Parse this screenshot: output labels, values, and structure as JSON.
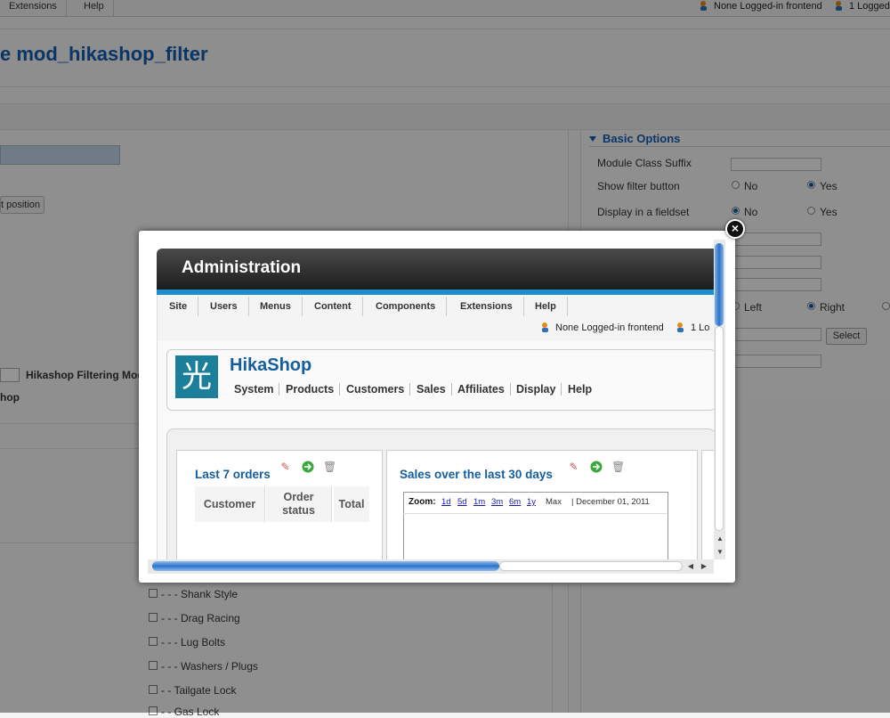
{
  "top_menu": {
    "extensions": "Extensions",
    "help": "Help"
  },
  "top_status": {
    "frontend": "None Logged-in frontend",
    "logged": "1 Logged"
  },
  "page_title": "e mod_hikashop_filter",
  "basic_options": {
    "title": "Basic Options",
    "module_class_suffix": "Module Class Suffix",
    "show_filter_button": "Show filter button",
    "display_in_fieldset": "Display in a fieldset",
    "no": "No",
    "yes": "Yes",
    "left": "Left",
    "right": "Right",
    "select": "Select"
  },
  "left_panel": {
    "position_button": "t position",
    "filtering_module": "Hikashop Filtering Mod",
    "shop": "hop"
  },
  "categories": [
    "- - - Shank Style",
    "- - - Drag Racing",
    "- - - Lug Bolts",
    "- - - Washers / Plugs",
    "- - Tailgate Lock",
    "- - Gas Lock"
  ],
  "modal": {
    "close": "×",
    "admin_title": "Administration",
    "nav": [
      "Site",
      "Users",
      "Menus",
      "Content",
      "Components",
      "Extensions",
      "Help"
    ],
    "status_frontend": "None Logged-in frontend",
    "status_logged": "1 Lo",
    "hikashop": {
      "logo": "光",
      "title": "HikaShop",
      "links": [
        "System",
        "Products",
        "Customers",
        "Sales",
        "Affiliates",
        "Display",
        "Help"
      ]
    },
    "orders": {
      "title": "Last 7 orders",
      "col_customer": "Customer",
      "col_status_1": "Order",
      "col_status_2": "status",
      "col_total": "Total"
    },
    "sales": {
      "title": "Sales over the last 30 days",
      "zoom_label": "Zoom:",
      "zoom_links": [
        "1d",
        "5d",
        "1m",
        "3m",
        "6m",
        "1y"
      ],
      "zoom_max": "Max",
      "date": "| December 01, 2011"
    }
  }
}
